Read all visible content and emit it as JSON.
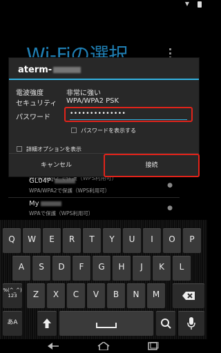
{
  "background": {
    "title": "Wi-Fiの選択",
    "partial_row_text": "WPA/WPA2 で保護（WPS利用可）",
    "networks": [
      {
        "ssid": "GL04P-",
        "security": "WPA/WPA2で保護（WPS利用可）",
        "icon": "wifi-signal-icon"
      },
      {
        "ssid": "My",
        "security": "WPAで保護（WPS利用可）",
        "icon": "wifi-signal-icon"
      }
    ]
  },
  "dialog": {
    "title": "aterm-",
    "signal_label": "電波強度",
    "signal_value": "非常に強い",
    "security_label": "セキュリティ",
    "security_value": "WPA/WPA2 PSK",
    "password_label": "パスワード",
    "password_value": "••••••••••••••",
    "show_password_label": "パスワードを表示する",
    "advanced_label": "詳細オプションを表示",
    "cancel_label": "キャンセル",
    "connect_label": "接続"
  },
  "keyboard": {
    "row1": [
      "Q",
      "W",
      "E",
      "R",
      "T",
      "Y",
      "U",
      "I",
      "O",
      "P"
    ],
    "row2": [
      "A",
      "S",
      "D",
      "F",
      "G",
      "H",
      "J",
      "K",
      "L"
    ],
    "row3": [
      "Z",
      "X",
      "C",
      "V",
      "B",
      "N",
      "M"
    ],
    "symbols_label": "%(^_^)\n123",
    "lang_label": "あA",
    "icons": [
      "shift-icon",
      "space-icon",
      "search-icon",
      "backspace-icon",
      "mic-icon"
    ]
  },
  "colors": {
    "accent": "#33b5e5",
    "highlight": "#e2231a",
    "title_blue": "#1f7fb4"
  }
}
